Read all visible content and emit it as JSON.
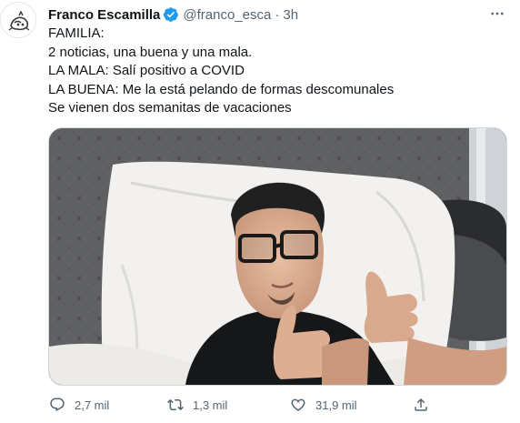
{
  "tweet": {
    "author_name": "Franco Escamilla",
    "handle": "@franco_esca",
    "separator": "·",
    "time": "3h",
    "lines": [
      "FAMILIA:",
      "2 noticias, una buena y una mala.",
      "LA MALA: Salí positivo a COVID",
      "LA BUENA: Me la está pelando de formas descomunales",
      "Se vienen dos semanitas de vacaciones"
    ]
  },
  "actions": {
    "replies": "2,7 mil",
    "retweets": "1,3 mil",
    "likes": "31,9 mil"
  },
  "icons": {
    "avatar": "profile-avatar",
    "verified": "verified-badge-icon",
    "more": "more-options-icon",
    "reply": "reply-icon",
    "retweet": "retweet-icon",
    "like": "heart-icon",
    "share": "share-icon"
  },
  "colors": {
    "verified": "#1d9bf0",
    "secondary_text": "#536471",
    "primary_text": "#0f1419"
  }
}
